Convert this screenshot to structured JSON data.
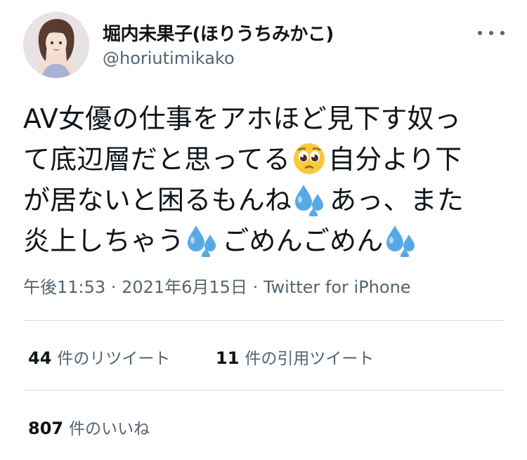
{
  "author": {
    "display_name": "堀内未果子(ほりうちみかこ)",
    "handle": "@horiutimikako",
    "avatar_icon": "profile-photo"
  },
  "more_icon": "more-options-icon",
  "tweet": {
    "lines": [
      [
        "AV女優の仕事をアホほど見下す奴っ"
      ],
      [
        "て底辺層だと思ってる",
        "自分より下"
      ],
      [
        "が居ないと困るもんね",
        "あっ、また"
      ],
      [
        "炎上しちゃう",
        "ごめんごめん",
        ""
      ]
    ],
    "emojis": [
      "pleading-face-emoji",
      "sweat-droplets-emoji"
    ]
  },
  "meta": {
    "time": "午後11:53",
    "separator": " · ",
    "date": "2021年6月15日",
    "source": "Twitter for iPhone"
  },
  "stats": {
    "retweets_count": "44",
    "retweets_label": "件のリツイート",
    "quotes_count": "11",
    "quotes_label": "件の引用ツイート",
    "likes_count": "807",
    "likes_label": "件のいいね"
  },
  "colors": {
    "text": "#0f1419",
    "secondary": "#536471",
    "divider": "#dadfe2",
    "droplet": "#57a9e6",
    "face": "#f7c93b"
  }
}
